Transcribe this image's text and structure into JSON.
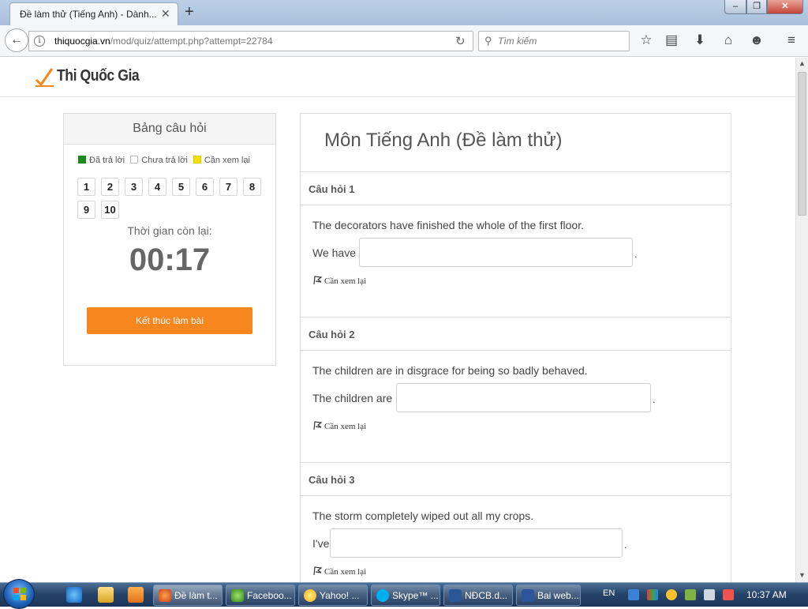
{
  "browser": {
    "tab_title": "Đề làm thử (Tiếng Anh) - Dành...",
    "tab_close": "✕",
    "new_tab": "+",
    "url_host": "thiquocgia.vn",
    "url_path": "/mod/quiz/attempt.php?attempt=22784",
    "search_placeholder": "Tìm kiếm",
    "window_buttons": {
      "minimize": "–",
      "maximize": "❐",
      "close": "✕"
    }
  },
  "site": {
    "logo_text": "Thi Quốc Gia",
    "brand_color": "#f7861f"
  },
  "quiz_nav": {
    "title": "Bảng câu hỏi",
    "legend": [
      {
        "label": "Đã trả lời",
        "color": "#1a8a1a"
      },
      {
        "label": "Chưa trả lời",
        "color": "#ffffff"
      },
      {
        "label": "Cần xem lại",
        "color": "#f5e000"
      }
    ],
    "questions": [
      "1",
      "2",
      "3",
      "4",
      "5",
      "6",
      "7",
      "8",
      "9",
      "10"
    ],
    "timer_label": "Thời gian còn lại:",
    "timer": "00:17",
    "finish_button": "Kết thúc làm bài"
  },
  "quiz": {
    "title": "Môn Tiếng Anh (Đề làm thử)",
    "flag_label": "Cần xem lại",
    "questions": [
      {
        "header": "Câu hỏi 1",
        "text": "The decorators have finished the whole of the first floor.",
        "prefix": "We have",
        "answer": "",
        "suffix": "."
      },
      {
        "header": "Câu hỏi 2",
        "text": "The children are in disgrace for being so badly behaved.",
        "prefix": "The children are",
        "answer": "",
        "suffix": "."
      },
      {
        "header": "Câu hỏi 3",
        "text": "The storm completely wiped out all my crops.",
        "prefix": "I've",
        "answer": "",
        "suffix": "."
      }
    ]
  },
  "taskbar": {
    "tasks": [
      "Đề làm t...",
      "Faceboo...",
      "Yahoo! ...",
      "Skype™ ...",
      "NĐCB.d...",
      "Bai web...."
    ],
    "language": "EN",
    "clock": "10:37 AM"
  }
}
